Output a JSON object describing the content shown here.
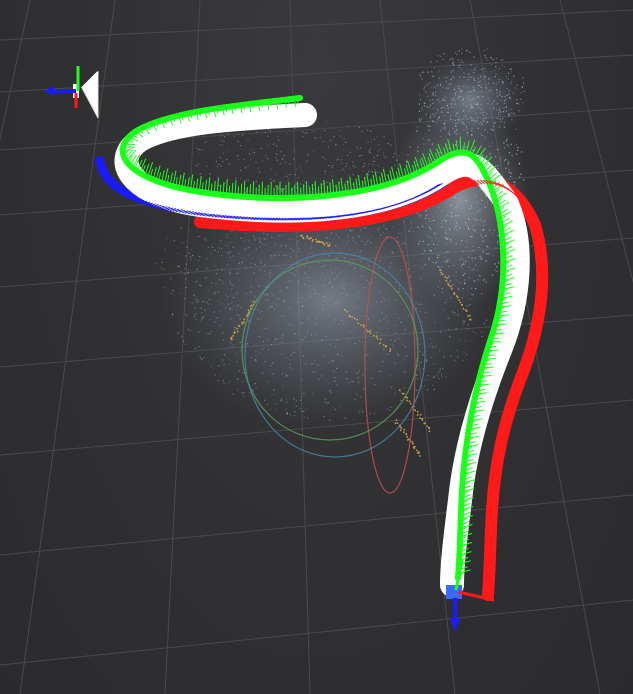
{
  "viewer": {
    "background_color": "#2f2f31",
    "grid_color": "#4a4a4e"
  },
  "trajectory": {
    "path_color": "#ffffff",
    "axis_x_color": "#ff1a1a",
    "axis_y_color": "#1aff1a",
    "axis_z_color": "#1a1aff"
  },
  "point_cloud": {
    "primary_color": "#8a96a8",
    "highlight_color": "#d9a84a"
  },
  "camera_markers": {
    "start_marker": "camera-frustum-icon",
    "end_marker": "coordinate-axes-icon"
  },
  "orbit_gizmo": {
    "ring_colors": [
      "#c05050",
      "#5a9a5a",
      "#4a8aaa"
    ]
  }
}
